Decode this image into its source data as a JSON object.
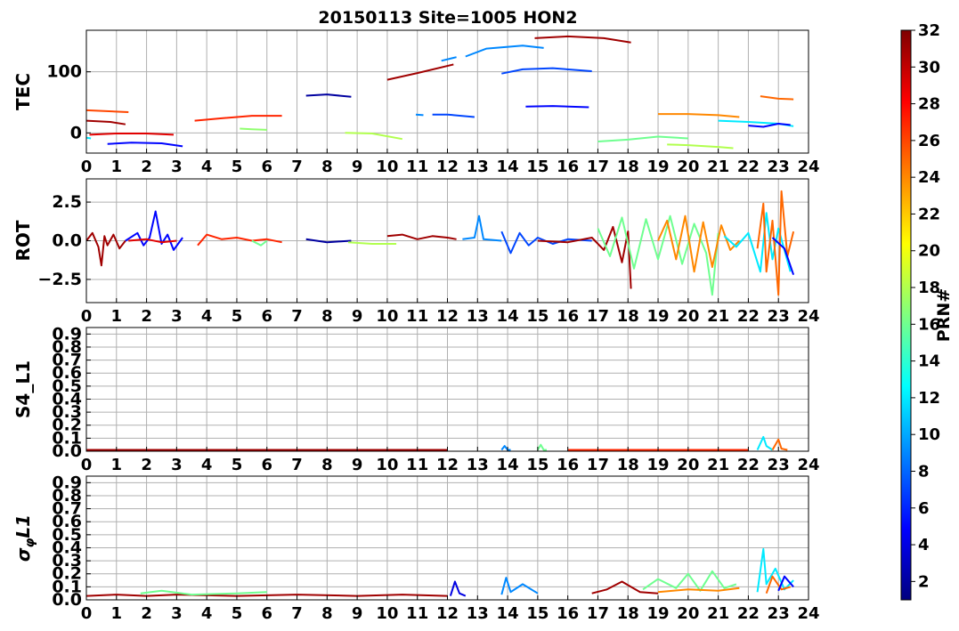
{
  "chart_data": {
    "type": "line",
    "title": "20150113 Site=1005 HON2",
    "x_ticks": [
      "0",
      "1",
      "2",
      "3",
      "4",
      "5",
      "6",
      "7",
      "8",
      "9",
      "10",
      "11",
      "12",
      "13",
      "14",
      "15",
      "16",
      "17",
      "18",
      "19",
      "20",
      "21",
      "22",
      "23",
      "24"
    ],
    "xlim": [
      0,
      24
    ],
    "grid": true,
    "panels": [
      {
        "id": "tec",
        "ylabel": "TEC",
        "ylim": [
          -33,
          168
        ],
        "y_ticks": [
          {
            "v": 0,
            "label": "0"
          },
          {
            "v": 100,
            "label": "100"
          }
        ],
        "series": [
          {
            "prn": 26,
            "x": [
              0,
              1.4
            ],
            "y": [
              37,
              34
            ]
          },
          {
            "prn": 31,
            "x": [
              0,
              0.8,
              1.3
            ],
            "y": [
              20,
              18,
              14
            ]
          },
          {
            "prn": 12,
            "x": [
              0,
              0.15
            ],
            "y": [
              -8,
              -9
            ]
          },
          {
            "prn": 29,
            "x": [
              0.1,
              1,
              2,
              2.9
            ],
            "y": [
              -3,
              -1,
              -1,
              -3
            ]
          },
          {
            "prn": 5,
            "x": [
              0.7,
              1.5,
              2.5,
              3.2
            ],
            "y": [
              -18,
              -16,
              -17,
              -22
            ]
          },
          {
            "prn": 27,
            "x": [
              3.6,
              4.5,
              5.5,
              6.5
            ],
            "y": [
              20,
              24,
              28,
              28
            ]
          },
          {
            "prn": 17,
            "x": [
              5.1,
              5.5,
              6
            ],
            "y": [
              7,
              6,
              5
            ]
          },
          {
            "prn": 2,
            "x": [
              7.3,
              8,
              8.8
            ],
            "y": [
              61,
              63,
              59
            ]
          },
          {
            "prn": 18,
            "x": [
              8.6,
              9.5,
              10.5
            ],
            "y": [
              0,
              -1,
              -10
            ]
          },
          {
            "prn": 31,
            "x": [
              10,
              11,
              12.2
            ],
            "y": [
              87,
              98,
              112
            ]
          },
          {
            "prn": 9,
            "x": [
              10.95,
              11.2
            ],
            "y": [
              30,
              29
            ]
          },
          {
            "prn": 7,
            "x": [
              11.5,
              12,
              12.9
            ],
            "y": [
              30,
              30,
              26
            ]
          },
          {
            "prn": 9,
            "x": [
              11.8,
              12.3
            ],
            "y": [
              118,
              124
            ]
          },
          {
            "prn": 9,
            "x": [
              12.6,
              13.3,
              14.5,
              15.2
            ],
            "y": [
              125,
              138,
              143,
              139
            ]
          },
          {
            "prn": 7,
            "x": [
              13.8,
              14.5,
              15.5,
              16.8
            ],
            "y": [
              97,
              104,
              106,
              101
            ]
          },
          {
            "prn": 5,
            "x": [
              14.6,
              15.5,
              16.7
            ],
            "y": [
              43,
              44,
              42
            ]
          },
          {
            "prn": 31,
            "x": [
              14.9,
              16,
              17.2,
              18.1
            ],
            "y": [
              155,
              158,
              155,
              148
            ]
          },
          {
            "prn": 16,
            "x": [
              17,
              18,
              19,
              20
            ],
            "y": [
              -14,
              -11,
              -6,
              -9
            ]
          },
          {
            "prn": 24,
            "x": [
              19,
              20,
              21,
              21.7
            ],
            "y": [
              31,
              31,
              29,
              26
            ]
          },
          {
            "prn": 18,
            "x": [
              19.3,
              20,
              21,
              21.5
            ],
            "y": [
              -19,
              -20,
              -23,
              -25
            ]
          },
          {
            "prn": 12,
            "x": [
              21,
              22,
              23,
              23.5
            ],
            "y": [
              20,
              18,
              15,
              11
            ]
          },
          {
            "prn": 5,
            "x": [
              22,
              22.5,
              23,
              23.4
            ],
            "y": [
              12,
              10,
              15,
              13
            ]
          },
          {
            "prn": 25,
            "x": [
              22.4,
              23,
              23.5
            ],
            "y": [
              60,
              56,
              55
            ]
          }
        ]
      },
      {
        "id": "rot",
        "ylabel": "ROT",
        "ylim": [
          -4,
          4
        ],
        "y_ticks": [
          {
            "v": 2.5,
            "label": "2.5"
          },
          {
            "v": 0,
            "label": "0.0"
          },
          {
            "v": -2.5,
            "label": "−2.5"
          }
        ],
        "series": [
          {
            "prn": 31,
            "x": [
              0,
              0.2,
              0.4,
              0.5,
              0.6,
              0.7,
              0.9,
              1.1,
              1.3
            ],
            "y": [
              0,
              0.5,
              -0.4,
              -1.6,
              0.3,
              -0.3,
              0.4,
              -0.5,
              0
            ]
          },
          {
            "prn": 5,
            "x": [
              1.3,
              1.7,
              1.9,
              2.1,
              2.3,
              2.5,
              2.7,
              2.9,
              3.2
            ],
            "y": [
              0,
              0.5,
              -0.3,
              0.2,
              1.9,
              -0.2,
              0.4,
              -0.6,
              0.2
            ]
          },
          {
            "prn": 29,
            "x": [
              1.4,
              2,
              2.5,
              3
            ],
            "y": [
              0,
              0.1,
              -0.1,
              0
            ]
          },
          {
            "prn": 27,
            "x": [
              3.7,
              4,
              4.5,
              5,
              5.5,
              6,
              6.5
            ],
            "y": [
              -0.3,
              0.4,
              0.1,
              0.2,
              0,
              0.1,
              -0.1
            ]
          },
          {
            "prn": 16,
            "x": [
              5.5,
              5.8,
              6
            ],
            "y": [
              0,
              -0.3,
              0
            ]
          },
          {
            "prn": 2,
            "x": [
              7.3,
              8,
              8.8
            ],
            "y": [
              0.1,
              -0.1,
              0
            ]
          },
          {
            "prn": 18,
            "x": [
              8.7,
              9.5,
              10.3
            ],
            "y": [
              -0.1,
              -0.2,
              -0.2
            ]
          },
          {
            "prn": 31,
            "x": [
              10,
              10.5,
              11,
              11.5,
              12,
              12.3
            ],
            "y": [
              0.3,
              0.4,
              0.1,
              0.3,
              0.2,
              0.1
            ]
          },
          {
            "prn": 9,
            "x": [
              12.5,
              12.9,
              13.05,
              13.2,
              13.8
            ],
            "y": [
              0.1,
              0.2,
              1.6,
              0.1,
              0
            ]
          },
          {
            "prn": 7,
            "x": [
              13.8,
              14.1,
              14.4,
              14.7,
              15,
              15.5,
              16,
              16.8
            ],
            "y": [
              0.6,
              -0.8,
              0.5,
              -0.3,
              0.2,
              -0.2,
              0.1,
              0
            ]
          },
          {
            "prn": 31,
            "x": [
              15,
              16,
              16.8,
              17.2,
              17.5,
              17.8,
              18,
              18.1
            ],
            "y": [
              0,
              -0.1,
              0.2,
              -0.6,
              0.9,
              -1.4,
              0.6,
              -3.1
            ]
          },
          {
            "prn": 16,
            "x": [
              17,
              17.4,
              17.8,
              18.2,
              18.6,
              19,
              19.4,
              19.8,
              20.2,
              20.6,
              20.8,
              21
            ],
            "y": [
              0.8,
              -1,
              1.5,
              -1.8,
              1.4,
              -1.2,
              1.6,
              -1.5,
              1.1,
              -0.8,
              -3.5,
              0.5
            ]
          },
          {
            "prn": 24,
            "x": [
              19,
              19.3,
              19.6,
              19.9,
              20.2,
              20.5,
              20.8,
              21.1,
              21.4,
              21.7
            ],
            "y": [
              0,
              1.3,
              -1.2,
              1.6,
              -2,
              1.2,
              -1.7,
              1,
              -0.6,
              0
            ]
          },
          {
            "prn": 12,
            "x": [
              21.2,
              21.6,
              22,
              22.4,
              22.6,
              22.8,
              23,
              23.4
            ],
            "y": [
              0.3,
              -0.4,
              0.5,
              -2,
              1.8,
              -1.2,
              0.8,
              -2
            ]
          },
          {
            "prn": 25,
            "x": [
              22.3,
              22.5,
              22.6,
              22.8,
              23,
              23.1,
              23.3,
              23.5
            ],
            "y": [
              -0.5,
              2.4,
              -2,
              1.3,
              -3.5,
              3.2,
              -1,
              0.6
            ]
          },
          {
            "prn": 5,
            "x": [
              22.8,
              23.2,
              23.5
            ],
            "y": [
              0.2,
              -0.5,
              -2.2
            ]
          }
        ]
      },
      {
        "id": "s4",
        "ylabel": "S4_L1",
        "ylim": [
          0,
          0.95
        ],
        "y_ticks": [
          {
            "v": 0,
            "label": "0.0"
          },
          {
            "v": 0.1,
            "label": "0.1"
          },
          {
            "v": 0.2,
            "label": "0.2"
          },
          {
            "v": 0.3,
            "label": "0.3"
          },
          {
            "v": 0.4,
            "label": "0.4"
          },
          {
            "v": 0.5,
            "label": "0.5"
          },
          {
            "v": 0.6,
            "label": "0.6"
          },
          {
            "v": 0.7,
            "label": "0.7"
          },
          {
            "v": 0.8,
            "label": "0.8"
          },
          {
            "v": 0.9,
            "label": "0.9"
          }
        ],
        "series": [
          {
            "prn": 31,
            "x": [
              0,
              3,
              6,
              9,
              12
            ],
            "y": [
              0.01,
              0.01,
              0.01,
              0.01,
              0.01
            ]
          },
          {
            "prn": 9,
            "x": [
              13.8,
              13.9,
              14,
              14.1
            ],
            "y": [
              0.01,
              0.04,
              0.01,
              0.01
            ]
          },
          {
            "prn": 16,
            "x": [
              15,
              15.1,
              15.2,
              15.3
            ],
            "y": [
              0.01,
              0.05,
              0.01,
              0.01
            ]
          },
          {
            "prn": 27,
            "x": [
              16,
              18,
              20,
              22
            ],
            "y": [
              0.01,
              0.01,
              0.01,
              0.01
            ]
          },
          {
            "prn": 12,
            "x": [
              22.3,
              22.5,
              22.6,
              22.8
            ],
            "y": [
              0.01,
              0.11,
              0.04,
              0.01
            ]
          },
          {
            "prn": 25,
            "x": [
              22.8,
              23,
              23.1,
              23.3
            ],
            "y": [
              0.01,
              0.09,
              0.02,
              0.01
            ]
          }
        ]
      },
      {
        "id": "sigphi",
        "ylabel": "σ_φL1",
        "ylim": [
          0,
          0.95
        ],
        "y_ticks": [
          {
            "v": 0,
            "label": "0.0"
          },
          {
            "v": 0.1,
            "label": "0.1"
          },
          {
            "v": 0.2,
            "label": "0.2"
          },
          {
            "v": 0.3,
            "label": "0.3"
          },
          {
            "v": 0.4,
            "label": "0.4"
          },
          {
            "v": 0.5,
            "label": "0.5"
          },
          {
            "v": 0.6,
            "label": "0.6"
          },
          {
            "v": 0.7,
            "label": "0.7"
          },
          {
            "v": 0.8,
            "label": "0.8"
          },
          {
            "v": 0.9,
            "label": "0.9"
          }
        ],
        "series": [
          {
            "prn": 31,
            "x": [
              0,
              1,
              2,
              3,
              5,
              7,
              9,
              10.5,
              12
            ],
            "y": [
              0.03,
              0.04,
              0.03,
              0.04,
              0.03,
              0.04,
              0.03,
              0.04,
              0.03
            ]
          },
          {
            "prn": 16,
            "x": [
              1.8,
              2.5,
              3.5,
              5,
              6
            ],
            "y": [
              0.05,
              0.07,
              0.04,
              0.05,
              0.06
            ]
          },
          {
            "prn": 4,
            "x": [
              12.1,
              12.25,
              12.4,
              12.6
            ],
            "y": [
              0.03,
              0.14,
              0.05,
              0.03
            ]
          },
          {
            "prn": 9,
            "x": [
              13.8,
              13.95,
              14.1,
              14.5,
              15
            ],
            "y": [
              0.04,
              0.17,
              0.06,
              0.12,
              0.05
            ]
          },
          {
            "prn": 31,
            "x": [
              16.8,
              17.3,
              17.8,
              18.1,
              18.4,
              19
            ],
            "y": [
              0.05,
              0.08,
              0.14,
              0.1,
              0.06,
              0.05
            ]
          },
          {
            "prn": 16,
            "x": [
              18.5,
              19,
              19.6,
              20,
              20.4,
              20.8,
              21.2,
              21.6
            ],
            "y": [
              0.08,
              0.16,
              0.09,
              0.2,
              0.07,
              0.22,
              0.09,
              0.12
            ]
          },
          {
            "prn": 24,
            "x": [
              19,
              20,
              21,
              21.7
            ],
            "y": [
              0.06,
              0.08,
              0.07,
              0.09
            ]
          },
          {
            "prn": 12,
            "x": [
              22.3,
              22.5,
              22.6,
              22.9,
              23.2,
              23.5
            ],
            "y": [
              0.06,
              0.39,
              0.12,
              0.24,
              0.08,
              0.15
            ]
          },
          {
            "prn": 25,
            "x": [
              22.6,
              22.8,
              23.1,
              23.4
            ],
            "y": [
              0.05,
              0.18,
              0.08,
              0.1
            ]
          },
          {
            "prn": 5,
            "x": [
              23,
              23.2,
              23.5
            ],
            "y": [
              0.07,
              0.18,
              0.1
            ]
          }
        ]
      }
    ],
    "colorbar": {
      "label": "PRN#",
      "min": 1,
      "max": 32,
      "ticks": [
        "2",
        "4",
        "6",
        "8",
        "10",
        "12",
        "14",
        "16",
        "18",
        "20",
        "22",
        "24",
        "26",
        "28",
        "30",
        "32"
      ],
      "colormap": "jet"
    }
  }
}
